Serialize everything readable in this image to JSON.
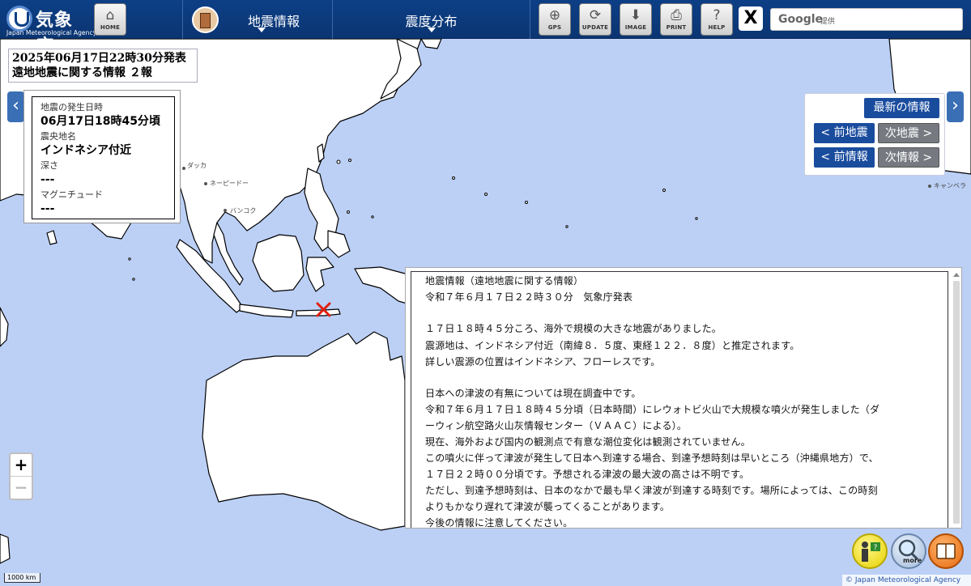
{
  "header": {
    "logo_text": "気象庁",
    "logo_sub": "Japan Meteorological Agency",
    "home_label": "HOME",
    "menu1_label": "地震情報",
    "menu2_label": "震度分布",
    "tools": [
      "GPS",
      "UPDATE",
      "IMAGE",
      "PRINT",
      "HELP"
    ],
    "x_label": "X",
    "search_brand": "Google",
    "search_sub": "提供"
  },
  "title": {
    "line1": "2025年06月17日22時30分発表",
    "line2": "遠地地震に関する情報 ２報"
  },
  "info": {
    "time_label": "地震の発生日時",
    "time_value": "06月17日18時45分頃",
    "place_label": "震央地名",
    "place_value": "インドネシア付近",
    "depth_label": "深さ",
    "depth_value": "---",
    "mag_label": "マグニチュード",
    "mag_value": "---"
  },
  "nav": {
    "latest": "最新の情報",
    "prev_quake": "< 前地震",
    "next_quake": "次地震 >",
    "prev_info": "< 前情報",
    "next_info": "次情報 >",
    "left_arrow": "‹",
    "right_arrow": "›"
  },
  "map_labels": {
    "dhaka": "ダッカ",
    "naypyidaw": "ネーピードー",
    "bangkok": "バンコク",
    "canberra": "キャンベラ"
  },
  "bulletin": {
    "lines": [
      "地震情報（遠地地震に関する情報）",
      "令和７年６月１７日２２時３０分　気象庁発表",
      "",
      "１７日１８時４５分ころ、海外で規模の大きな地震がありました。",
      "震源地は、インドネシア付近（南緯８．５度、東経１２２．８度）と推定されます。",
      "詳しい震源の位置はインドネシア、フローレスです。",
      "",
      "日本への津波の有無については現在調査中です。",
      "令和７年６月１７日１８時４５分頃（日本時間）にレウォトビ火山で大規模な噴火が発生しました（ダ",
      "ーウィン航空路火山灰情報センター（ＶＡＡＣ）による）。",
      "現在、海外および国内の観測点で有意な潮位変化は観測されていません。",
      "この噴火に伴って津波が発生して日本へ到達する場合、到達予想時刻は早いところ（沖縄県地方）で、",
      "１７日２２時００分頃です。予想される津波の最大波の高さは不明です。",
      "ただし、到達予想時刻は、日本のなかで最も早く津波が到達する時刻です。場所によっては、この時刻",
      "よりもかなり遅れて津波が襲ってくることがあります。",
      "今後の情報に注意してください。"
    ]
  },
  "zoom": {
    "plus": "+",
    "minus": "−"
  },
  "round_buttons": [
    "help-person-icon",
    "more-magnifier-icon",
    "book-icon"
  ],
  "more_label": "more",
  "scale": "1000 km",
  "attribution": "© Japan Meteorological Agency",
  "colors": {
    "sea": "#bcd0f6",
    "land": "#ffffff",
    "header": "#0d3f86",
    "epicenter": "#e02010"
  }
}
